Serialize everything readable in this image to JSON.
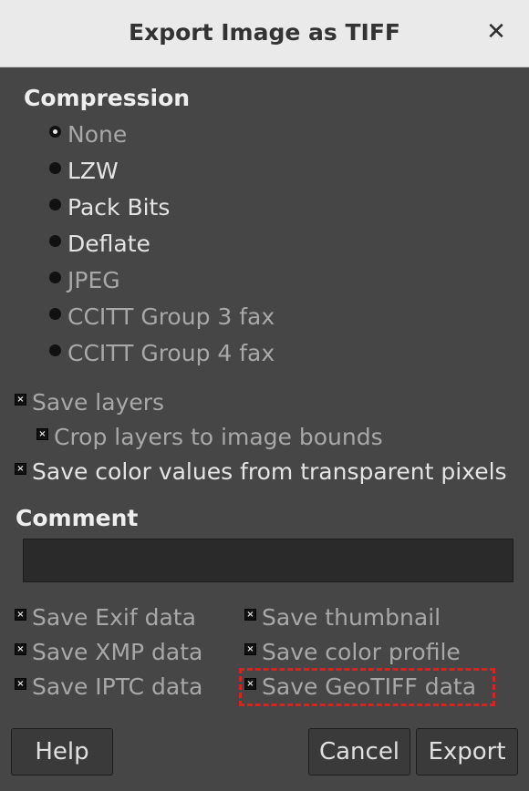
{
  "window": {
    "title": "Export Image as TIFF"
  },
  "compression": {
    "heading": "Compression",
    "options": [
      {
        "label": "None",
        "selected": true
      },
      {
        "label": "LZW"
      },
      {
        "label": "Pack Bits"
      },
      {
        "label": "Deflate"
      },
      {
        "label": "JPEG"
      },
      {
        "label": "CCITT Group 3 fax"
      },
      {
        "label": "CCITT Group 4 fax"
      }
    ]
  },
  "layers": {
    "save_layers": "Save layers",
    "crop_layers": "Crop layers to image bounds",
    "save_color_values": "Save color values from transparent pixels"
  },
  "comment": {
    "heading": "Comment",
    "value": ""
  },
  "metadata": {
    "exif": "Save Exif data",
    "xmp": "Save XMP data",
    "iptc": "Save IPTC data",
    "thumbnail": "Save thumbnail",
    "color_profile": "Save color profile",
    "geotiff": "Save GeoTIFF data"
  },
  "buttons": {
    "help": "Help",
    "cancel": "Cancel",
    "export": "Export"
  },
  "icons": {
    "close": "close-icon",
    "check_mark": "×"
  },
  "colors": {
    "highlight": "#d42525"
  }
}
